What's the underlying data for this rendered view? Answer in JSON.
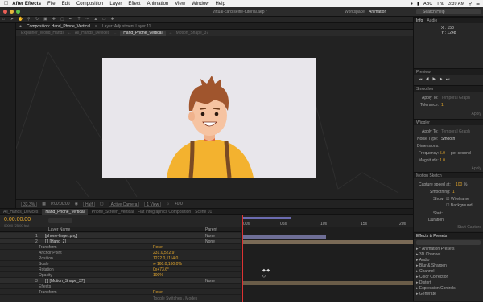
{
  "menubar": {
    "app": "After Effects",
    "items": [
      "File",
      "Edit",
      "Composition",
      "Layer",
      "Effect",
      "Animation",
      "View",
      "Window",
      "Help"
    ],
    "status": [
      "ABC",
      "Thu",
      "3:39 AM"
    ]
  },
  "window": {
    "title": "virtual-card-selfie-tutorial.aep *",
    "workspace_label": "Workspace:",
    "workspace_value": "Animation",
    "search_placeholder": "Search Help"
  },
  "comp_panel": {
    "tab": "Composition: Hand_Phone_Vertical",
    "layer_tab": "Layer: Adjustment Layer 11",
    "subtabs": [
      "Explainer_World_Hands",
      "All_Hands_Devices",
      "Hand_Phone_Vertical",
      "Motion_Shape_37"
    ],
    "active_subtab": 2,
    "footer": {
      "zoom": "33.3%",
      "time": "0:00:00:00",
      "resolution": "Half",
      "camera": "Active Camera",
      "views": "1 View",
      "offset": "+0.0"
    }
  },
  "info": {
    "tabs": [
      "Info",
      "Audio"
    ],
    "x": "X : 150",
    "y": "Y : 1248"
  },
  "preview": {
    "tab": "Preview"
  },
  "smoother": {
    "tab": "Smoother",
    "apply_to_label": "Apply To:",
    "apply_to_value": "Temporal Graph",
    "tolerance_label": "Tolerance:",
    "tolerance_value": "1",
    "apply_btn": "Apply"
  },
  "wiggler": {
    "tab": "Wiggler",
    "apply_to_label": "Apply To:",
    "apply_to_value": "Temporal Graph",
    "noise_label": "Noise Type:",
    "noise_value": "Smooth",
    "dimensions_label": "Dimensions:",
    "frequency_label": "Frequency:",
    "frequency_value": "5.0",
    "frequency_unit": "per second",
    "magnitude_label": "Magnitude:",
    "magnitude_value": "1.0",
    "apply_btn": "Apply"
  },
  "motion_sketch": {
    "tab": "Motion Sketch",
    "capture_label": "Capture speed at:",
    "capture_value": "100",
    "capture_unit": "%",
    "smoothing_label": "Smoothing:",
    "smoothing_value": "1",
    "show_label": "Show:",
    "wireframe": "Wireframe",
    "background": "Background",
    "start_label": "Start:",
    "duration_label": "Duration:",
    "start_btn": "Start Capture"
  },
  "effects": {
    "tab": "Effects & Presets",
    "items": [
      "* Animation Presets",
      "3D Channel",
      "Audio",
      "Blur & Sharpen",
      "Channel",
      "Color Correction",
      "Distort",
      "Expression Controls",
      "Generate"
    ]
  },
  "timeline": {
    "tabs": [
      "All_Hands_Devices",
      "Hand_Phone_Vertical",
      "Phone_Screen_Vertical",
      "Flat Infographics Composition",
      "Scene 01"
    ],
    "active_tab": 1,
    "timecode": "0:00:00:00",
    "timecode_sub": "00000 (25.00 fps)",
    "col_layer": "Layer Name",
    "col_parent": "Parent",
    "ruler": [
      "00s",
      "05s",
      "10s",
      "15s",
      "20s"
    ],
    "toggle": "Toggle Switches / Modes",
    "layers": [
      {
        "num": "1",
        "name": "[phone-finger.png]",
        "parent": "None"
      },
      {
        "num": "2",
        "name": "[ ] [Hand_2]",
        "parent": "None"
      },
      {
        "num": "",
        "name": "Transform",
        "value": "Reset"
      },
      {
        "num": "",
        "name": "Anchor Point",
        "value": "231.0,522.9"
      },
      {
        "num": "",
        "name": "Position",
        "value": "1222.0,1114.0"
      },
      {
        "num": "",
        "name": "Scale",
        "value": "∞ 160.0,160.0%"
      },
      {
        "num": "",
        "name": "Rotation",
        "value": "0x+73.6°"
      },
      {
        "num": "",
        "name": "Opacity",
        "value": "100%"
      },
      {
        "num": "3",
        "name": "[ ] [Motion_Shape_37]",
        "parent": "None"
      },
      {
        "num": "",
        "name": "Effects",
        "value": ""
      },
      {
        "num": "",
        "name": "Transform",
        "value": "Reset"
      }
    ]
  }
}
